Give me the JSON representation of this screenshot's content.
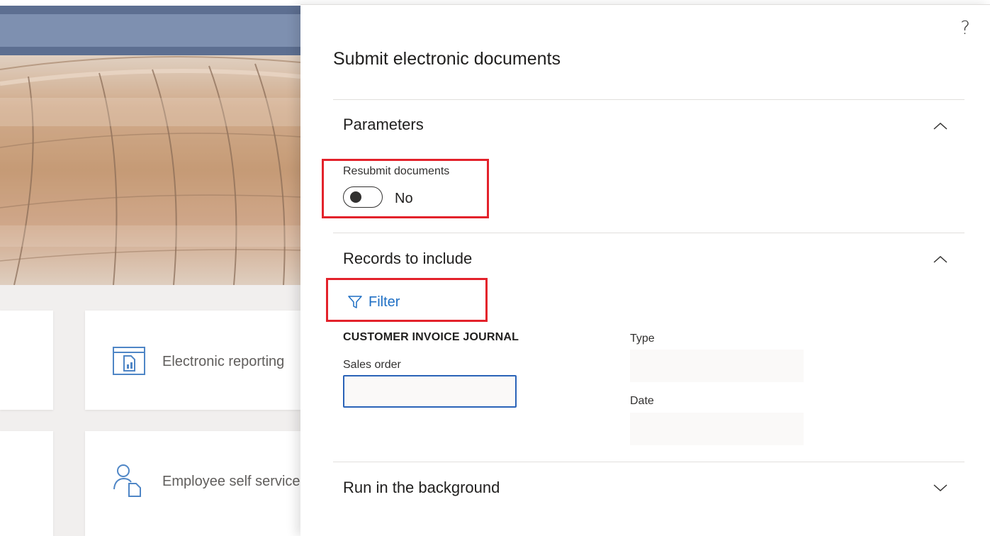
{
  "background": {
    "tiles": [
      {
        "label": "Electronic reporting",
        "icon": "report-icon"
      },
      {
        "label": "Employee self service",
        "icon": "employee-icon"
      }
    ]
  },
  "dialog": {
    "title": "Submit electronic documents",
    "help_icon": "?",
    "sections": {
      "parameters": {
        "title": "Parameters",
        "expanded": true,
        "resubmit": {
          "label": "Resubmit documents",
          "value_text": "No",
          "on": false
        }
      },
      "records": {
        "title": "Records to include",
        "expanded": true,
        "filter_label": "Filter",
        "group_title": "CUSTOMER INVOICE JOURNAL",
        "sales_order": {
          "label": "Sales order",
          "value": ""
        },
        "type": {
          "label": "Type",
          "value": ""
        },
        "date": {
          "label": "Date",
          "value": ""
        }
      },
      "background": {
        "title": "Run in the background",
        "expanded": false
      }
    }
  },
  "colors": {
    "highlight": "#e3222b",
    "accent": "#1f6fc4",
    "navbar": "#7e90b0"
  }
}
